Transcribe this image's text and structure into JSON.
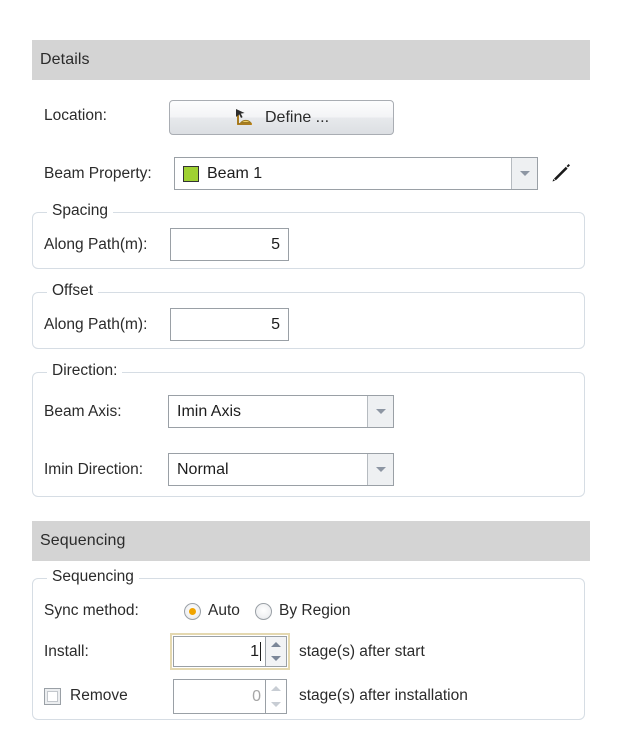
{
  "sections": {
    "details": {
      "header": "Details",
      "location": {
        "label": "Location:",
        "button_label": "Define ...",
        "button_icon": "protractor-angle-icon"
      },
      "beam_property": {
        "label": "Beam Property:",
        "value": "Beam 1",
        "swatch_color": "#9fd132",
        "edit_icon": "pencil-icon",
        "dropdown_icon": "chevron-down-icon"
      },
      "spacing": {
        "title": "Spacing",
        "along_path_label": "Along Path(m):",
        "along_path_value": "5"
      },
      "offset": {
        "title": "Offset",
        "along_path_label": "Along Path(m):",
        "along_path_value": "5"
      },
      "direction": {
        "title": "Direction:",
        "beam_axis_label": "Beam Axis:",
        "beam_axis_value": "Imin Axis",
        "imin_direction_label": "Imin Direction:",
        "imin_direction_value": "Normal"
      }
    },
    "sequencing": {
      "header": "Sequencing",
      "group_title": "Sequencing",
      "sync_method_label": "Sync method:",
      "radio_auto_label": "Auto",
      "radio_by_region_label": "By Region",
      "install_label": "Install:",
      "install_value": "1",
      "install_suffix": "stage(s) after start",
      "remove_label": "Remove",
      "remove_value": "0",
      "remove_suffix": "stage(s) after installation"
    }
  },
  "colors": {
    "section_band": "#d4d4d4",
    "radio_selected": "#f0a400",
    "swatch": "#9fd132",
    "focus_border": "#e4d8b0"
  }
}
